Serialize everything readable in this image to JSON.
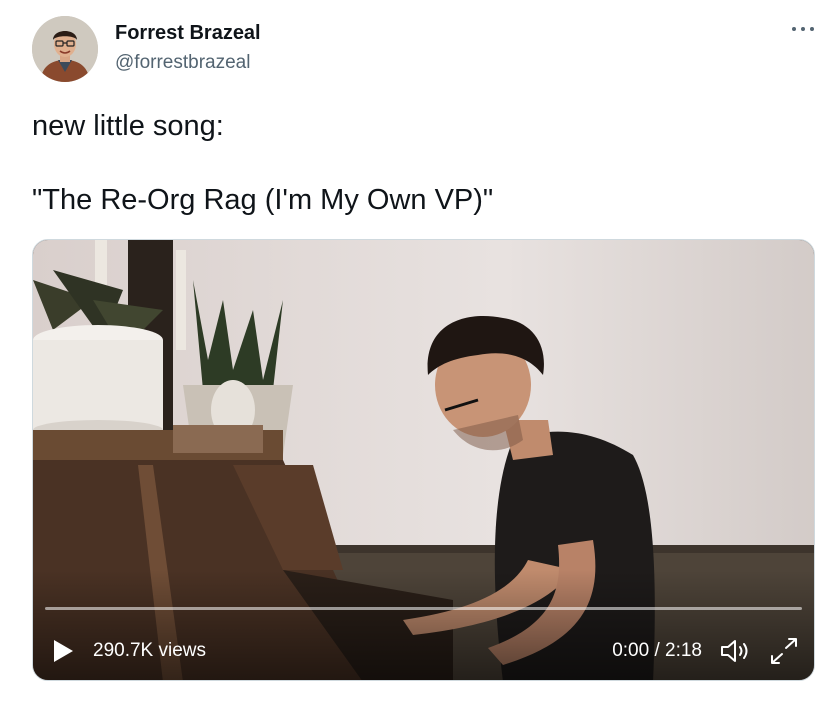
{
  "author": {
    "name": "Forrest Brazeal",
    "handle": "@forrestbrazeal",
    "avatar_icon": "profile-photo"
  },
  "more_icon": "more-horizontal-icon",
  "tweet": {
    "line1": "new little song:",
    "line2": "\"The Re-Org Rag (I'm My Own VP)\""
  },
  "video": {
    "views": "290.7K views",
    "time": "0:00 / 2:18",
    "progress_fraction": 0,
    "play_icon": "play-icon",
    "volume_icon": "volume-icon",
    "fullscreen_icon": "fullscreen-icon"
  },
  "colors": {
    "text": "#0f1419",
    "secondary": "#536471",
    "border": "#cfd9de"
  }
}
